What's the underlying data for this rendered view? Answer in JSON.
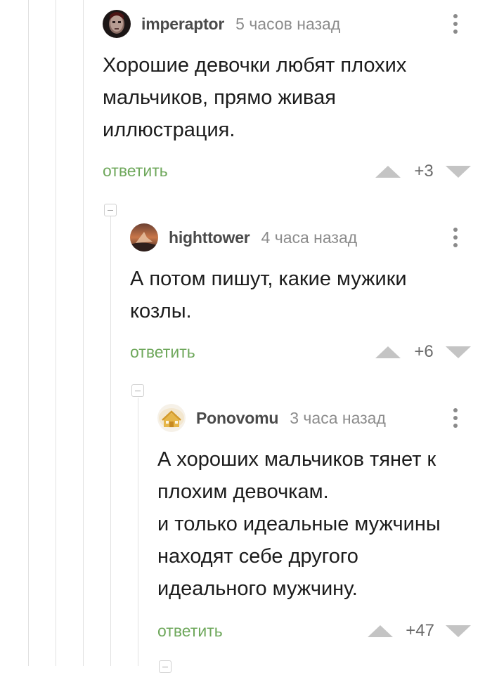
{
  "colors": {
    "reply_link": "#6fa85c",
    "thread_line": "#e1e1e1",
    "vote_arrow": "#c4c4c4"
  },
  "comments": [
    {
      "author": "imperaptor",
      "time": "5 часов назад",
      "avatar_icon": "user-avatar-dark",
      "text": "Хорошие девочки любят плохих\nмальчиков, прямо живая\nиллюстрация.",
      "reply_label": "ответить",
      "rating": "+3"
    },
    {
      "author": "highttower",
      "time": "4 часа назад",
      "avatar_icon": "user-avatar-sunset",
      "text": "А потом пишут, какие мужики\nкозлы.",
      "reply_label": "ответить",
      "rating": "+6"
    },
    {
      "author": "Ponovomu",
      "time": "3 часа назад",
      "avatar_icon": "user-avatar-house",
      "text": "А хороших мальчиков тянет к\nплохим девочкам.\nи только идеальные мужчины\nнаходят себе другого\nидеального мужчину.",
      "reply_label": "ответить",
      "rating": "+47"
    }
  ]
}
